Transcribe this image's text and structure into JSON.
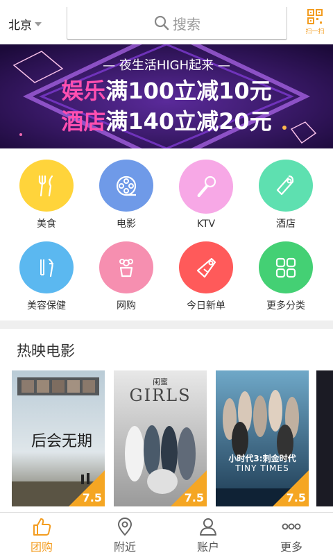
{
  "header": {
    "city": "北京",
    "search_placeholder": "搜索",
    "scan_label": "扫一扫"
  },
  "banner": {
    "line1": "— 夜生活HIGH起来 —",
    "line2_hl": "娱乐",
    "line2_rest": "满100立减10元",
    "line3_hl": "酒店",
    "line3_rest": "满140立减20元"
  },
  "categories": [
    {
      "label": "美食",
      "icon": "fork-knife-icon",
      "color": "#ffd43b"
    },
    {
      "label": "电影",
      "icon": "film-reel-icon",
      "color": "#6f9ae8"
    },
    {
      "label": "KTV",
      "icon": "microphone-icon",
      "color": "#f7a8e6"
    },
    {
      "label": "酒店",
      "icon": "door-hanger-icon",
      "color": "#5ee0b0"
    },
    {
      "label": "美容保健",
      "icon": "beauty-tools-icon",
      "color": "#5bb8f0"
    },
    {
      "label": "网购",
      "icon": "gift-icon",
      "color": "#f68fb0"
    },
    {
      "label": "今日新单",
      "icon": "price-tag-icon",
      "color": "#ff5a5a"
    },
    {
      "label": "更多分类",
      "icon": "grid-icon",
      "color": "#44d074"
    }
  ],
  "movies": {
    "section_title": "热映电影",
    "items": [
      {
        "title": "后会无期",
        "score": "7.5",
        "bg": "#8aa5b8"
      },
      {
        "title": "GIRLS",
        "subtitle": "闺蜜",
        "score": "7.5",
        "bg": "#c9c9c9"
      },
      {
        "title": "小时代3:刺金时代",
        "subtitle": "TINY TIMES",
        "score": "7.5",
        "bg": "#3c6f8e"
      }
    ]
  },
  "tabs": [
    {
      "label": "团购",
      "icon": "thumbs-up-icon",
      "active": true
    },
    {
      "label": "附近",
      "icon": "location-pin-icon",
      "active": false
    },
    {
      "label": "账户",
      "icon": "user-icon",
      "active": false
    },
    {
      "label": "更多",
      "icon": "more-dots-icon",
      "active": false
    }
  ],
  "colors": {
    "accent": "#f39c1f",
    "banner_bg": "#2a1250",
    "banner_highlight": "#ff4fb0"
  }
}
